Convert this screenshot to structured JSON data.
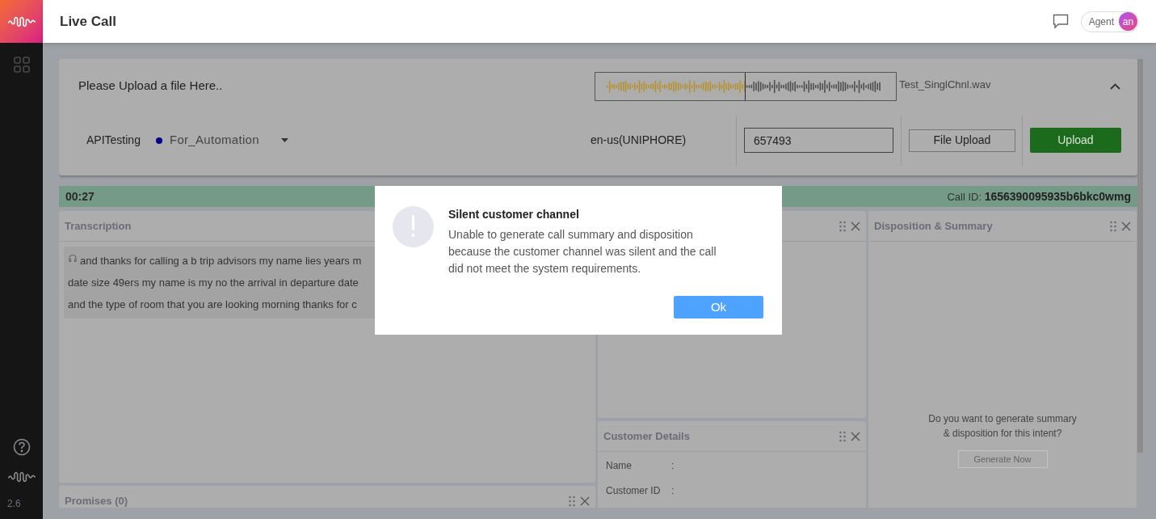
{
  "header": {
    "title": "Live Call",
    "agent_label": "Agent",
    "avatar_initials": "an"
  },
  "sidebar": {
    "version": "2.6"
  },
  "upload_card": {
    "prompt": "Please Upload a file Here..",
    "file_name": "Test_SinglChnl.wav",
    "project": "APITesting",
    "workflow": "For_Automation",
    "language": "en-us(UNIPHORE)",
    "id_field": {
      "value": "657493"
    },
    "file_upload_button": "File Upload",
    "upload_button": "Upload"
  },
  "call_bar": {
    "timer": "00:27",
    "call_id_label": "Call ID:",
    "call_id": "1656390095935b6bkc0wmg"
  },
  "transcription_panel": {
    "title": "Transcription",
    "lines": [
      "and thanks for calling a b trip advisors my name lies years m",
      "date size 49ers my name is my no the arrival in departure date",
      "and the type of room that you are looking morning thanks for c"
    ]
  },
  "promises_panel": {
    "title": "Promises (0)"
  },
  "customer_details_panel": {
    "title": "Customer Details",
    "fields": [
      {
        "label": "Name",
        "separator": ":"
      },
      {
        "label": "Customer ID",
        "separator": ":"
      }
    ]
  },
  "disposition_panel": {
    "title": "Disposition & Summary",
    "prompt_lines": [
      "Do you want to generate summary",
      "& disposition for this intent?"
    ],
    "button": "Generate Now"
  },
  "dialog": {
    "title": "Silent customer channel",
    "message": "Unable to generate call summary and disposition because the customer channel was silent and the call did not meet the system requirements.",
    "ok_button": "Ok"
  }
}
